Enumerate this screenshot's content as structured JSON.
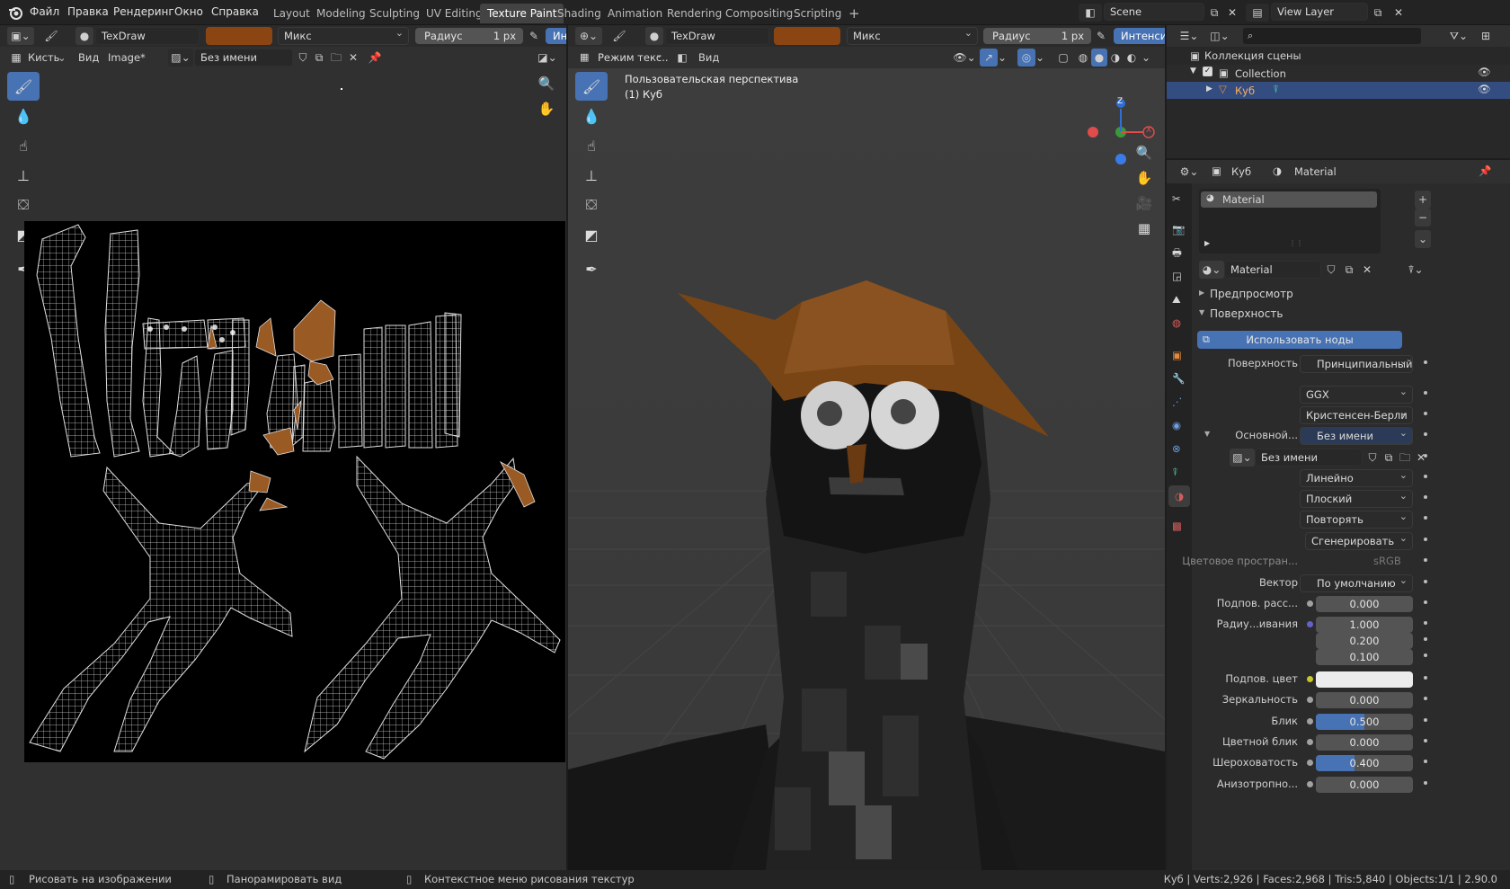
{
  "top_menu": {
    "items": [
      "Файл",
      "Правка",
      "Рендеринг",
      "Окно",
      "Справка"
    ],
    "workspaces": [
      "Layout",
      "Modeling",
      "Sculpting",
      "UV Editing",
      "Texture Paint",
      "Shading",
      "Animation",
      "Rendering",
      "Compositing",
      "Scripting"
    ],
    "active_workspace": "Texture Paint",
    "add_tab": "+",
    "scene": "Scene",
    "view_layer": "View Layer"
  },
  "image_editor": {
    "brush": "TexDraw",
    "blend": "Микс",
    "radius_label": "Радиус",
    "radius_value": "1 px",
    "strength_trunc": "Ин",
    "brush_menu": "Кисть",
    "view_menu": "Вид",
    "image_menu": "Image*",
    "image_name": "Без имени",
    "brush_color": "#8b4513"
  },
  "viewport": {
    "brush": "TexDraw",
    "blend": "Микс",
    "radius_label": "Радиус",
    "radius_value": "1 px",
    "strength_label": "Интенсив",
    "mode": "Режим текс...",
    "view_menu": "Вид",
    "overlay_title": "Пользовательская перспектива",
    "overlay_object": "(1) Куб",
    "gizmo": {
      "z": "Z",
      "x": "X"
    }
  },
  "outliner": {
    "search_placeholder": "",
    "root": "Коллекция сцены",
    "collection": "Collection",
    "object": "Куб"
  },
  "properties": {
    "object": "Куб",
    "material_tab": "Material",
    "slot": "Material",
    "material_name": "Material",
    "sections": {
      "preview": "Предпросмотр",
      "surface": "Поверхность"
    },
    "use_nodes": "Использовать ноды",
    "rows": [
      {
        "label": "Поверхность",
        "value": "Принципиальный В...",
        "socket": "#4dbb4d"
      },
      {
        "label": "",
        "value": "GGX"
      },
      {
        "label": "",
        "value": "Кристенсен-Берли"
      },
      {
        "label": "Основной...",
        "value": "Без имени",
        "socket": "#c7c729"
      },
      {
        "label": "",
        "value": "Без имени"
      },
      {
        "label": "",
        "value": "Линейно"
      },
      {
        "label": "",
        "value": "Плоский"
      },
      {
        "label": "",
        "value": "Повторять"
      },
      {
        "label": "",
        "value": "Сгенерировать"
      },
      {
        "label": "Цветовое простран...",
        "value": "sRGB"
      },
      {
        "label": "Вектор",
        "value": "По умолчанию",
        "socket": "#6363c7"
      },
      {
        "label": "Подпов. расс...",
        "value": "0.000",
        "socket": "#a1a1a1"
      },
      {
        "label": "Радиу...ивания",
        "value": "1.000",
        "socket": "#6363c7"
      },
      {
        "label": "",
        "value": "0.200"
      },
      {
        "label": "",
        "value": "0.100"
      },
      {
        "label": "Подпов. цвет",
        "value": "",
        "socket": "#c7c729"
      },
      {
        "label": "Зеркальность",
        "value": "0.000",
        "socket": "#a1a1a1"
      },
      {
        "label": "Блик",
        "value": "0.500",
        "socket": "#a1a1a1",
        "fill": 0.5
      },
      {
        "label": "Цветной блик",
        "value": "0.000",
        "socket": "#a1a1a1"
      },
      {
        "label": "Шероховатость",
        "value": "0.400",
        "socket": "#a1a1a1",
        "fill": 0.4
      },
      {
        "label": "Анизотропно...",
        "value": "0.000",
        "socket": "#a1a1a1"
      }
    ]
  },
  "status": {
    "left": "Рисовать на изображении",
    "middle": "Панорамировать вид",
    "right": "Контекстное меню рисования текстур",
    "stats": "Куб | Verts:2,926 | Faces:2,968 | Tris:5,840 | Objects:1/1 | 2.90.0"
  }
}
